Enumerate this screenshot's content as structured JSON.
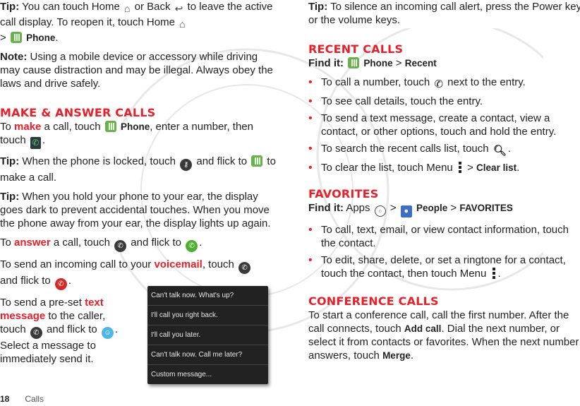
{
  "left": {
    "tip1": {
      "label": "Tip:",
      "t1": " You can touch Home ",
      "t2": " or Back ",
      "t3": " to leave the active call display. To reopen it, touch Home ",
      "t4": " > ",
      "phone": "Phone",
      "end": "."
    },
    "note": {
      "label": "Note:",
      "text": " Using a mobile device or accessory while driving may cause distraction and may be illegal. Always obey the laws and drive safely."
    },
    "heading": "MAKE & ANSWER CALLS",
    "make": {
      "t1": "To ",
      "kw": "make",
      "t2": " a call, touch ",
      "phone": "Phone",
      "t3": ", enter a number, then touch ",
      "end": "."
    },
    "tip2": {
      "label": "Tip:",
      "t1": " When the phone is locked, touch ",
      "t2": " and flick to ",
      "t3": " to make a call."
    },
    "tip3": {
      "label": "Tip:",
      "text": " When you hold your phone to your ear, the display goes dark to prevent accidental touches. When you move the phone away from your ear, the display lights up again."
    },
    "answer": {
      "t1": "To ",
      "kw": "answer",
      "t2": " a call, touch ",
      "t3": " and flick to ",
      "end": "."
    },
    "voicemail": {
      "t1": "To send an incoming call to your ",
      "kw": "voicemail",
      "t2": ", touch ",
      "t3": " and flick to ",
      "end": "."
    },
    "textmsg": {
      "t1": "To send a pre-set ",
      "kw": "text message",
      "t2": " to the caller, touch ",
      "t3": " and flick to ",
      "t4": ". Select a message to immediately send it."
    }
  },
  "popup": {
    "items": [
      "Can't talk now. What's up?",
      "I'll call you right back.",
      "I'll call you later.",
      "Can't talk now. Call me later?",
      "Custom message..."
    ]
  },
  "right": {
    "tip": {
      "label": "Tip:",
      "text": " To silence an incoming call alert, press the Power key or the volume keys."
    },
    "recent": {
      "heading": "RECENT CALLS",
      "findit": "Find it:",
      "phone": "Phone",
      "sep": " > ",
      "recent": "Recent",
      "b1": {
        "t1": "To call a number, touch ",
        "t2": " next to the entry."
      },
      "b2": "To see call details, touch the entry.",
      "b3": "To send a text message, create a contact, view a contact, or other options, touch and hold the entry.",
      "b4": {
        "t1": "To search the recent calls list, touch ",
        "end": "."
      },
      "b5": {
        "t1": "To clear the list, touch Menu ",
        "t2": " > ",
        "clear": "Clear list",
        "end": "."
      }
    },
    "favorites": {
      "heading": "FAVORITES",
      "findit": "Find it:",
      "apps": " Apps ",
      "sep": " > ",
      "people": "People",
      "fav": "FAVORITES",
      "b1": "To call, text, email, or view contact information, touch the contact.",
      "b2": {
        "t1": "To edit, share, delete, or set a ringtone for a contact, touch the contact, then touch Menu ",
        "end": "."
      }
    },
    "conference": {
      "heading": "CONFERENCE CALLS",
      "t1": "To start a conference call, call the first number. After the call connects, touch ",
      "add": "Add call",
      "t2": ". Dial the next number, or select it from contacts or favorites. When the next number answers, touch ",
      "merge": "Merge",
      "end": "."
    }
  },
  "footer": {
    "page": "18",
    "section": "Calls"
  },
  "icons": {
    "home": "⌂",
    "back": "↩",
    "handset": "✆",
    "search": "🔍",
    "people": "👤",
    "apps": "⁘",
    "msg": "☺"
  }
}
